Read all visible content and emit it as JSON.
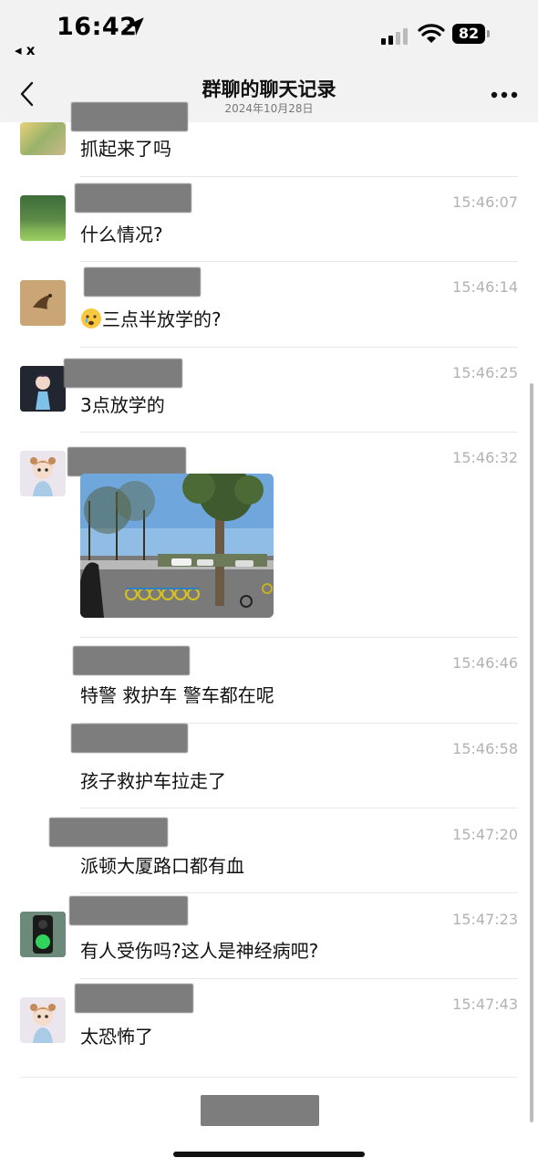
{
  "status_bar": {
    "time": "16:42",
    "back_app": "◂ x",
    "battery": "82"
  },
  "nav": {
    "title": "群聊的聊天记录",
    "date": "2024年10月28日"
  },
  "messages": [
    {
      "time": "",
      "text": "抓起来了吗"
    },
    {
      "time": "15:46:07",
      "text": "什么情况?"
    },
    {
      "time": "15:46:14",
      "text": "三点半放学的?"
    },
    {
      "time": "15:46:25",
      "text": "3点放学的"
    },
    {
      "time": "15:46:32",
      "text": ""
    },
    {
      "time": "15:46:46",
      "text": "特警 救护车 警车都在呢"
    },
    {
      "time": "15:46:58",
      "text": "孩子救护车拉走了"
    },
    {
      "time": "15:47:20",
      "text": "派顿大厦路口都有血"
    },
    {
      "time": "15:47:23",
      "text": "有人受伤吗?这人是神经病吧?"
    },
    {
      "time": "15:47:43",
      "text": "太恐怖了"
    }
  ],
  "icons": {
    "back": "chevron-left-icon",
    "more": "more-dots-icon",
    "signal": "cellular-signal-icon",
    "wifi": "wifi-icon",
    "location": "location-arrow-icon"
  },
  "colors": {
    "bar_bg": "#f2f2f2",
    "time_text": "#b2b2b2",
    "redaction": "#7d7d7d"
  }
}
